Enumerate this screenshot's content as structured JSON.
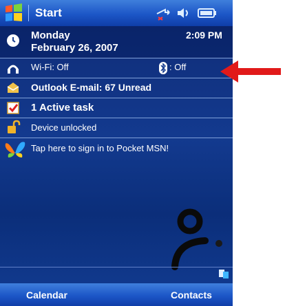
{
  "titlebar": {
    "title": "Start",
    "time_clock_hidden": ""
  },
  "date_row": {
    "day": "Monday",
    "date": "February 26, 2007",
    "time": "2:09 PM"
  },
  "wireless_row": {
    "wifi": "Wi-Fi: Off",
    "bluetooth": ": Off"
  },
  "email_row": {
    "label": "Outlook E-mail: 67 Unread"
  },
  "tasks_row": {
    "label": "1 Active task"
  },
  "lock_row": {
    "label": "Device unlocked"
  },
  "msn_row": {
    "label": "Tap here to sign in to Pocket MSN!"
  },
  "softkeys": {
    "left": "Calendar",
    "right": "Contacts"
  },
  "colors": {
    "accent": "#1c56c7",
    "background": "#133a8f",
    "arrow": "#e11a1a"
  }
}
